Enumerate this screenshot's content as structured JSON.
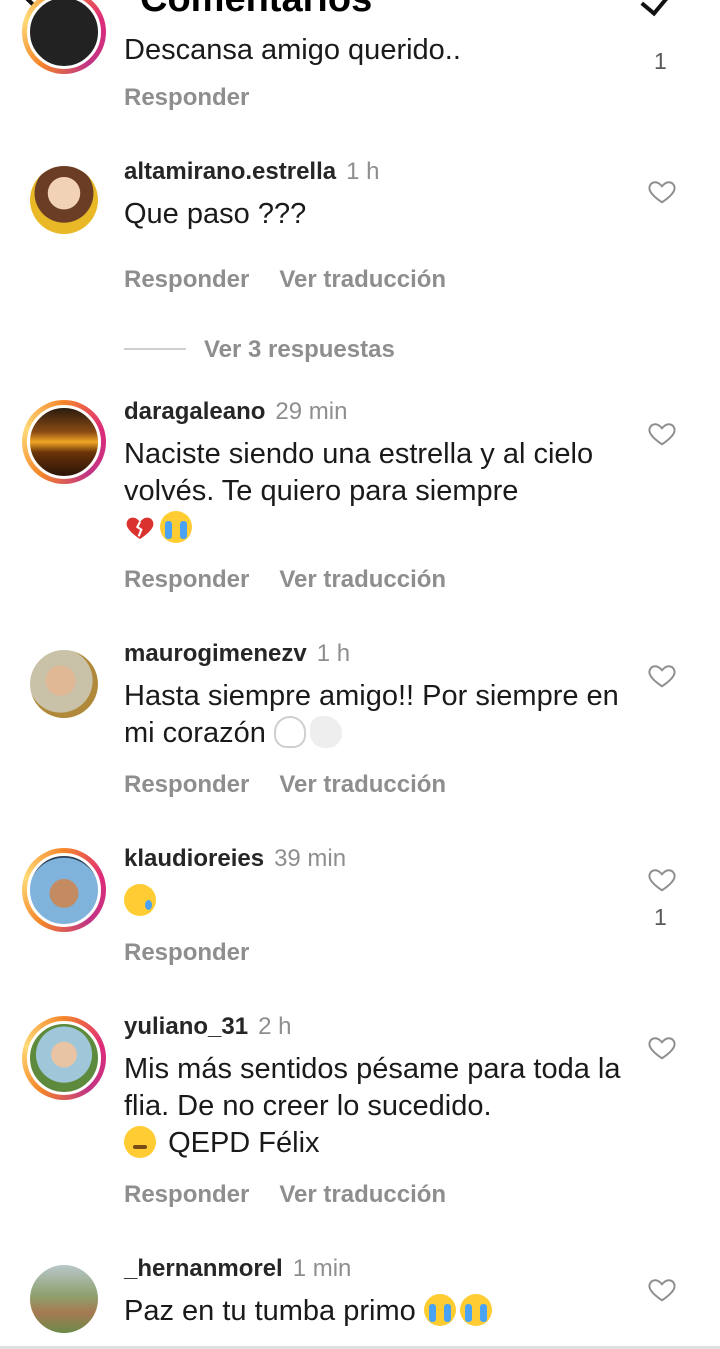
{
  "header": {
    "title": "Comentarios"
  },
  "actions": {
    "reply": "Responder",
    "translate": "Ver traducción"
  },
  "replies_toggle": "Ver 3 respuestas",
  "comments": [
    {
      "user": "",
      "time": "",
      "text": "Descansa amigo querido..",
      "likes": "1"
    },
    {
      "user": "altamirano.estrella",
      "time": "1 h",
      "text": "Que paso ???",
      "likes": ""
    },
    {
      "user": "daragaleano",
      "time": "29 min",
      "text": "Naciste siendo una estrella y al cielo volvés. Te quiero para siempre",
      "likes": ""
    },
    {
      "user": "maurogimenezv",
      "time": "1 h",
      "text": "Hasta siempre amigo!! Por siempre en mi corazón",
      "likes": ""
    },
    {
      "user": "klaudioreies",
      "time": "39 min",
      "text": "",
      "likes": "1"
    },
    {
      "user": "yuliano_31",
      "time": "2 h",
      "text": "Mis más sentidos pésame para toda la flia. De no creer lo sucedido.",
      "text_tail": "QEPD Félix",
      "likes": ""
    },
    {
      "user": "_hernanmorel",
      "time": "1 min",
      "text": "Paz en tu tumba primo",
      "likes": ""
    }
  ],
  "icons": [
    "back-arrow-icon",
    "checkmark-icon",
    "heart-icon"
  ],
  "colors": {
    "secondary_text": "#8e8e8e",
    "story_ring": "#dd2a7b"
  }
}
